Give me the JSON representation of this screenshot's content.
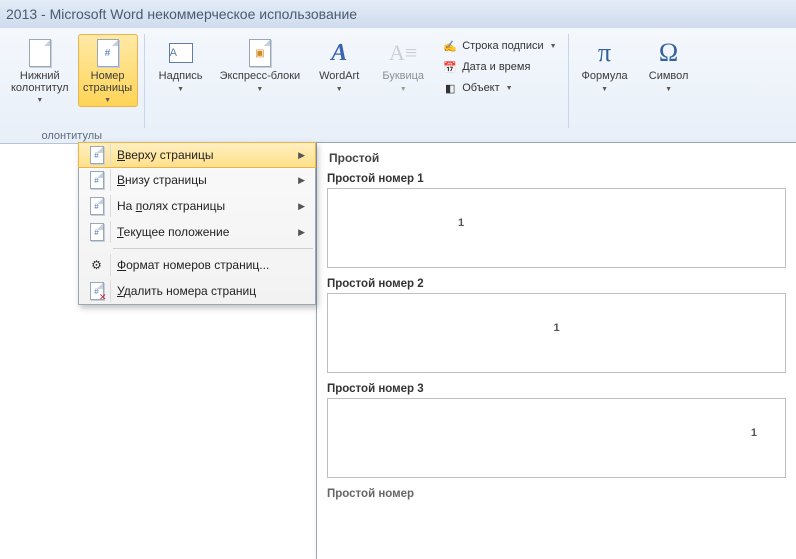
{
  "title": "2013 - Microsoft Word некоммерческое использование",
  "ribbon": {
    "groups": {
      "headerfooter": {
        "lower": {
          "label": "Нижний\nколонтитул"
        },
        "pagenum": {
          "label": "Номер\nстраницы"
        },
        "group_label": "олонтитулы"
      },
      "text": {
        "textbox": "Надпись",
        "quickparts": "Экспресс-блоки",
        "wordart": "WordArt",
        "dropcap": "Буквица",
        "sigline": "Строка подписи",
        "datetime": "Дата и время",
        "object": "Объект"
      },
      "symbols": {
        "equation": "Формула",
        "symbol": "Символ"
      }
    }
  },
  "menu": {
    "items": [
      {
        "icon": "#",
        "label": "Вверху страницы",
        "arrow": true,
        "highlight": true,
        "accel": "В"
      },
      {
        "icon": "#",
        "label": "Внизу страницы",
        "arrow": true,
        "accel": "В"
      },
      {
        "icon": "#",
        "label": "На полях страницы",
        "arrow": true,
        "accel": "п"
      },
      {
        "icon": "#",
        "label": "Текущее положение",
        "arrow": true,
        "accel": "Т"
      },
      {
        "sep": true
      },
      {
        "icon": "fmt",
        "label": "Формат номеров страниц...",
        "arrow": false,
        "accel": "Ф"
      },
      {
        "icon": "del",
        "label": "Удалить номера страниц",
        "arrow": false,
        "accel": "У"
      }
    ]
  },
  "gallery": {
    "section": "Простой",
    "items": [
      {
        "title": "Простой номер 1",
        "pos": "left",
        "num": "1"
      },
      {
        "title": "Простой номер 2",
        "pos": "center",
        "num": "1"
      },
      {
        "title": "Простой номер 3",
        "pos": "right",
        "num": "1"
      }
    ],
    "truncated": "Простой номер"
  }
}
